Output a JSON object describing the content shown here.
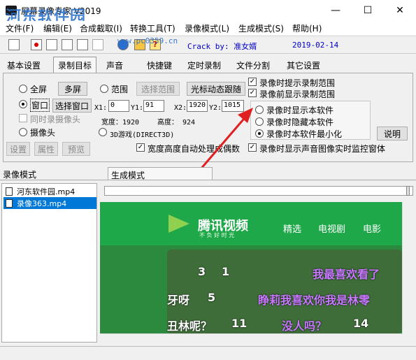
{
  "window": {
    "title": "屏幕录像专家 V2019",
    "minimize": "—",
    "maximize": "☐",
    "close": "✕"
  },
  "watermark": {
    "main": "河东软件园",
    "url": "www.pc0359.cn"
  },
  "menu": [
    "文件(F)",
    "编辑(E)",
    "合成截取(I)",
    "转换工具(T)",
    "录像模式(L)",
    "生成模式(S)",
    "帮助(H)"
  ],
  "toolbar": {
    "crack_text": "Crack by: 准女婿",
    "date": "2019-02-14"
  },
  "tabs": [
    "基本设置",
    "录制目标",
    "声音",
    "快捷键",
    "定时录制",
    "文件分割",
    "其它设置"
  ],
  "target": {
    "fullscreen": "全屏",
    "multiscreen": "多屏",
    "range": "范围",
    "select_range": "选择范围",
    "follow_cursor": "光标动态跟随",
    "window": "窗口",
    "select_window": "选择窗口",
    "x1_label": "X1:",
    "x1": "0",
    "y1_label": "Y1:",
    "y1": "91",
    "x2_label": "X2:",
    "x2": "1920",
    "y2_label": "Y2:",
    "y2": "1015",
    "sim_camera": "同时录摄像头",
    "width_text": "宽度：1920",
    "height_text": "高度：  924",
    "camera": "摄像头",
    "game3d": "3D游戏(DIRECT3D)",
    "btn_settings": "设置",
    "btn_props": "属性",
    "btn_preview": "预览",
    "auto_even": "宽度高度自动处理成偶数",
    "prompt_range": "录像时提示录制范围",
    "show_range_before": "录像前显示录制范围",
    "show_self": "录像时显示本软件",
    "hide_self": "录像时隐藏本软件",
    "minimize_self": "录像时本软件最小化",
    "explain": "说明",
    "monitor": "录像时显示声音图像实时监控窗体"
  },
  "lower": {
    "record_mode_tab": "录像模式",
    "gen_mode_tab": "生成模式",
    "files": [
      "河东软件园.mp4",
      "录像363.mp4"
    ]
  },
  "preview": {
    "brand": "腾讯视频",
    "slogan": "不 负 好 时 光",
    "nav": [
      "精选",
      "电视剧",
      "电影"
    ],
    "danmu": [
      {
        "count": "3",
        "like2": "1",
        "text": "我最喜欢看了"
      },
      {
        "pre": "牙呀",
        "count": "5",
        "text": "睁莉我喜欢你我是林零"
      },
      {
        "pre": "丑林呢？",
        "count": "11",
        "text": "没人吗？",
        "count2": "14"
      }
    ]
  },
  "colors": {
    "selection": "#0078d7",
    "arrow": "#e02020",
    "tencent_green": "#1fa84a"
  }
}
